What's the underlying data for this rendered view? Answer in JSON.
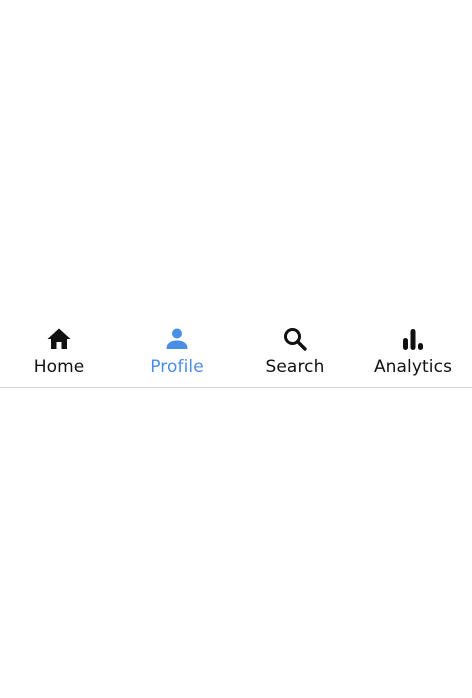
{
  "tabbar": {
    "active_color": "#4a8fe7",
    "inactive_color": "#111111",
    "items": [
      {
        "label": "Home",
        "icon": "home-icon",
        "active": false
      },
      {
        "label": "Profile",
        "icon": "person-icon",
        "active": true
      },
      {
        "label": "Search",
        "icon": "search-icon",
        "active": false
      },
      {
        "label": "Analytics",
        "icon": "bar-chart-icon",
        "active": false
      }
    ]
  }
}
